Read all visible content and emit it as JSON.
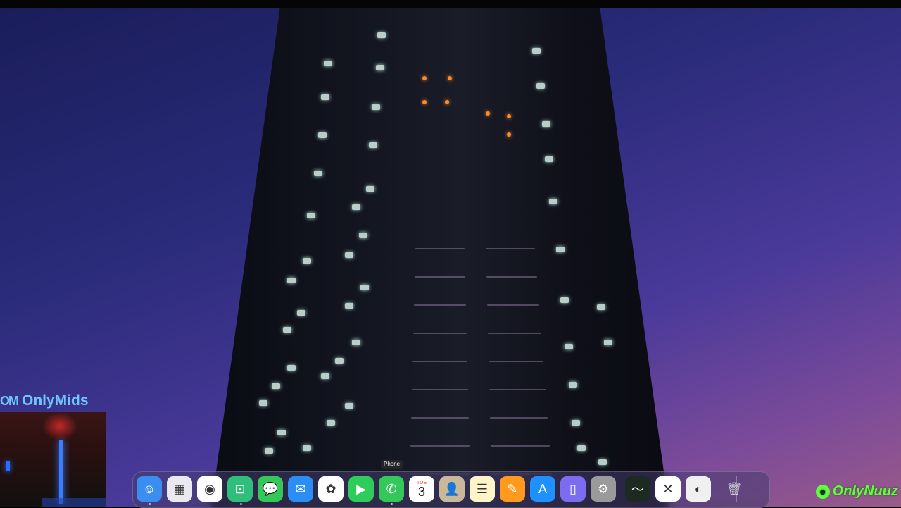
{
  "overlay": {
    "webcam_brand": "OnlyMids",
    "webcam_logo": "OM",
    "watermark": "OnlyNuuz"
  },
  "dock": {
    "tooltip": "Phone",
    "items": [
      {
        "id": "finder",
        "name": "Finder",
        "glyph": "☺",
        "color": "#3a8ef0"
      },
      {
        "id": "launchpad",
        "name": "Launchpad",
        "glyph": "▦",
        "color": "#e9e9ef"
      },
      {
        "id": "chrome",
        "name": "Google Chrome",
        "glyph": "◉",
        "color": "#ffffff"
      },
      {
        "id": "remote",
        "name": "Remote Desktop",
        "glyph": "⊡",
        "color": "#2fbf7a"
      },
      {
        "id": "messages",
        "name": "Messages",
        "glyph": "💬",
        "color": "#34c759"
      },
      {
        "id": "mail",
        "name": "Mail",
        "glyph": "✉",
        "color": "#2b8ef5"
      },
      {
        "id": "photos",
        "name": "Photos",
        "glyph": "✿",
        "color": "#ffffff"
      },
      {
        "id": "facetime",
        "name": "FaceTime",
        "glyph": "▶",
        "color": "#2ecc5a"
      },
      {
        "id": "phone",
        "name": "Phone",
        "glyph": "✆",
        "color": "#34c759"
      },
      {
        "id": "calendar",
        "name": "Calendar",
        "month": "TUE",
        "day": "3",
        "color": "#ffffff"
      },
      {
        "id": "contacts",
        "name": "Contacts",
        "glyph": "👤",
        "color": "#c9b89a"
      },
      {
        "id": "notes",
        "name": "Notes",
        "glyph": "☰",
        "color": "#fdf5c8"
      },
      {
        "id": "pages",
        "name": "Pages",
        "glyph": "✎",
        "color": "#ff9a1f"
      },
      {
        "id": "appstore",
        "name": "App Store",
        "glyph": "A",
        "color": "#1e90ff"
      },
      {
        "id": "iphone-mirroring",
        "name": "iPhone Mirroring",
        "glyph": "▯",
        "color": "#7b6cf0"
      },
      {
        "id": "settings",
        "name": "System Settings",
        "glyph": "⚙",
        "color": "#9a9a9a"
      },
      {
        "id": "activity-monitor",
        "name": "Activity Monitor",
        "glyph": "〜",
        "color": "#1d2a22"
      },
      {
        "id": "capcut",
        "name": "CapCut",
        "glyph": "✕",
        "color": "#ffffff"
      },
      {
        "id": "utility",
        "name": "Utility",
        "glyph": "◐",
        "color": "#f0f0f0"
      },
      {
        "id": "trash",
        "name": "Trash",
        "glyph": "🗑",
        "color": "transparent"
      }
    ]
  }
}
